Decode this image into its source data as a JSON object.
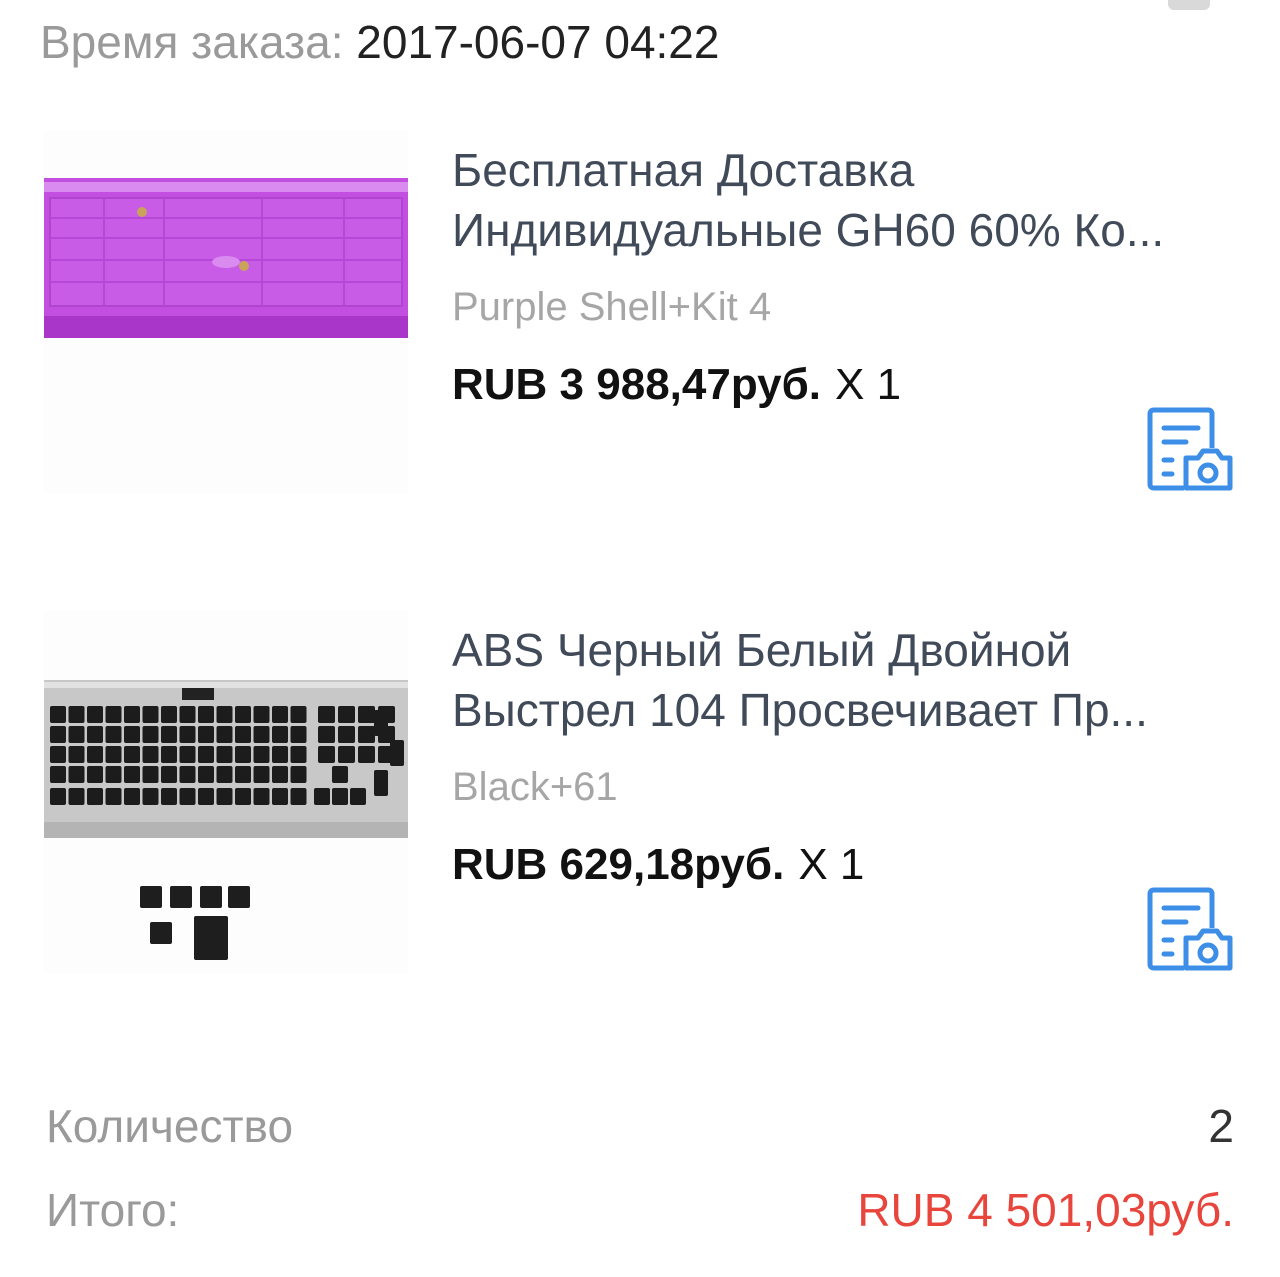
{
  "order": {
    "time_label": "Время заказа:",
    "time_value": "2017-06-07 04:22"
  },
  "items": [
    {
      "title_line1": "Бесплатная Доставка",
      "title_line2": "Индивидуальные GH60 60% Ко...",
      "variant": "Purple Shell+Kit 4",
      "price": "RUB 3 988,47руб.",
      "quantity": "X 1",
      "image": "purple-keyboard-case",
      "action_icon": "review-photo-icon"
    },
    {
      "title_line1": "ABS Черный Белый Двойной",
      "title_line2": "Выстрел 104 Просвечивает Пр...",
      "variant": "Black+61",
      "price": "RUB 629,18руб.",
      "quantity": "X 1",
      "image": "black-keycaps-keyboard",
      "action_icon": "review-photo-icon"
    }
  ],
  "summary": {
    "quantity_label": "Количество",
    "quantity_value": "2",
    "total_label": "Итого:",
    "total_value": "RUB 4 501,03руб."
  },
  "colors": {
    "accent_blue": "#3c8ee6",
    "total_red": "#e8453c",
    "label_gray": "#9a9a9a",
    "title_slate": "#404a58",
    "purple_case": "#c04ee0"
  }
}
